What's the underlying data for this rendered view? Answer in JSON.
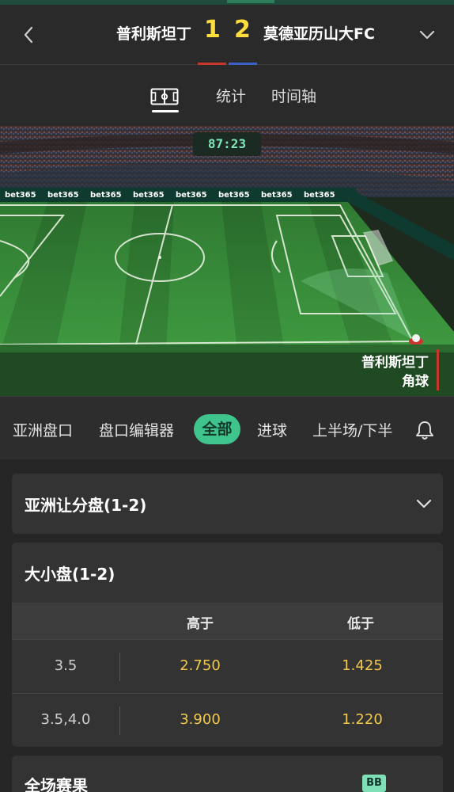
{
  "match": {
    "home_team": "普利斯坦丁",
    "away_team": "莫德亚历山大FC",
    "home_score": "1",
    "away_score": "2",
    "colors": {
      "home": "#c9372c",
      "away": "#3a62c4",
      "score": "#ffdd3c"
    }
  },
  "tabs": {
    "items": [
      "统计",
      "时间轴"
    ]
  },
  "live": {
    "clock": "87:23",
    "event_team": "普利斯坦丁",
    "event_type": "角球",
    "board_text": "bet365"
  },
  "filters": {
    "items": [
      "亚洲盘口",
      "盘口编辑器",
      "全部",
      "进球",
      "上半场/下半"
    ],
    "active": "全部",
    "accent": "#3ec48c"
  },
  "markets": {
    "asian_handicap": {
      "title": "亚洲让分盘(1-2)"
    },
    "over_under": {
      "title": "大小盘(1-2)",
      "columns": [
        "高于",
        "低于"
      ],
      "rows": [
        {
          "line": "3.5",
          "over": "2.750",
          "under": "1.425"
        },
        {
          "line": "3.5,4.0",
          "over": "3.900",
          "under": "1.220"
        }
      ],
      "odds_color": "#f2c94c"
    },
    "full_time": {
      "title": "全场赛果",
      "badge": "BB"
    }
  },
  "icons": [
    "back-chevron-icon",
    "chevron-down-icon",
    "pitch-icon",
    "bell-icon",
    "expand-chevron-icon"
  ]
}
